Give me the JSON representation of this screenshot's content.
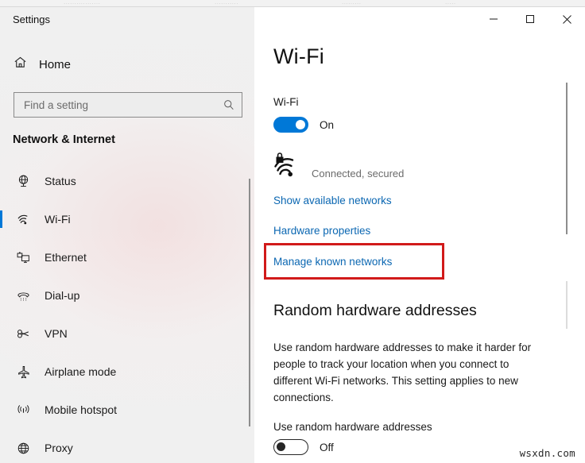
{
  "window": {
    "title": "Settings",
    "controls": {
      "minimize": "minimize-button",
      "maximize": "maximize-button",
      "close": "close-button"
    }
  },
  "sidebar": {
    "home_label": "Home",
    "search": {
      "placeholder": "Find a setting",
      "value": ""
    },
    "section_title": "Network & Internet",
    "items": [
      {
        "label": "Status",
        "icon": "status-globe-icon",
        "selected": false
      },
      {
        "label": "Wi-Fi",
        "icon": "wifi-icon",
        "selected": true
      },
      {
        "label": "Ethernet",
        "icon": "ethernet-icon",
        "selected": false
      },
      {
        "label": "Dial-up",
        "icon": "dialup-phone-icon",
        "selected": false
      },
      {
        "label": "VPN",
        "icon": "vpn-key-icon",
        "selected": false
      },
      {
        "label": "Airplane mode",
        "icon": "airplane-icon",
        "selected": false
      },
      {
        "label": "Mobile hotspot",
        "icon": "mobile-hotspot-icon",
        "selected": false
      },
      {
        "label": "Proxy",
        "icon": "proxy-globe-icon",
        "selected": false
      }
    ]
  },
  "main": {
    "page_title": "Wi-Fi",
    "wifi": {
      "sub_label": "Wi-Fi",
      "toggle_state": "On",
      "status_text": "Connected, secured",
      "status_icon": "wifi-secured-icon"
    },
    "links": [
      {
        "label": "Show available networks",
        "highlighted": false
      },
      {
        "label": "Hardware properties",
        "highlighted": false
      },
      {
        "label": "Manage known networks",
        "highlighted": true
      }
    ],
    "random_hw": {
      "heading": "Random hardware addresses",
      "description": "Use random hardware addresses to make it harder for people to track your location when you connect to different Wi-Fi networks. This setting applies to new connections.",
      "sub_label": "Use random hardware addresses",
      "toggle_state": "Off"
    }
  },
  "watermark": "wsxdn.com",
  "colors": {
    "accent": "#0078d7",
    "link": "#0b67b2",
    "highlight": "#d11a1a",
    "sidebar_bg": "#f0f0f0",
    "main_bg": "#ffffff"
  }
}
